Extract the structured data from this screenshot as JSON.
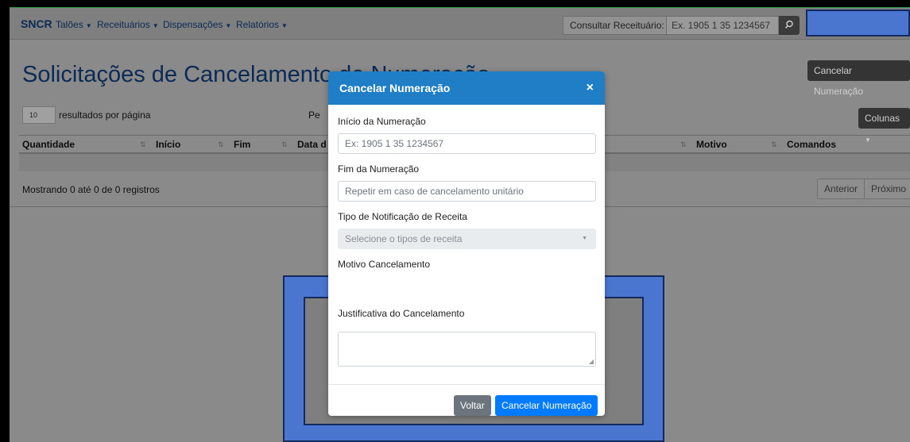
{
  "navbar": {
    "brand": "SNCR",
    "menu": [
      {
        "label": "Talões"
      },
      {
        "label": "Receituários"
      },
      {
        "label": "Dispensações"
      },
      {
        "label": "Relatórios"
      }
    ],
    "consult_label": "Consultar Receituário:",
    "consult_placeholder": "Ex. 1905 1 35 1234567"
  },
  "page": {
    "title": "Solicitações de Cancelamento de Numeração",
    "cancel_button": "Cancelar Numeração",
    "per_page_value": "10",
    "per_page_label": "resultados por página",
    "search_peek": "Pe",
    "columns_button": "Colunas",
    "table_headers": [
      "Quantidade",
      "Início",
      "Fim",
      "Data d",
      "Motivo",
      "Comandos"
    ],
    "showing": "Mostrando 0 até 0 de 0 registros",
    "pager": {
      "prev": "Anterior",
      "next": "Próximo"
    }
  },
  "modal": {
    "title": "Cancelar Numeração",
    "close": "×",
    "start_label": "Início da Numeração",
    "start_placeholder": "Ex: 1905 1 35 1234567",
    "end_label": "Fim da Numeração",
    "end_placeholder": "Repetir em caso de cancelamento unitário",
    "type_label": "Tipo de Notificação de Receita",
    "type_placeholder": "Selecione o tipos de receita",
    "reason_label": "Motivo Cancelamento",
    "justification_label": "Justificativa do Cancelamento",
    "back_button": "Voltar",
    "submit_button": "Cancelar Numeração"
  },
  "colors": {
    "primary": "#007bff",
    "header_blue": "#1f7ec6",
    "highlight_blue": "#4a76cf",
    "secondary": "#6c757d"
  }
}
